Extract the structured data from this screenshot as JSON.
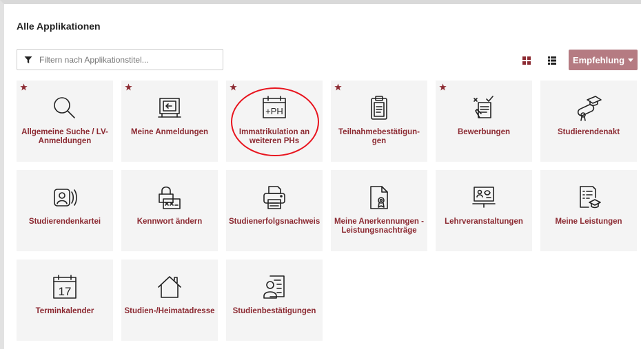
{
  "page": {
    "title": "Alle Applikationen"
  },
  "filter": {
    "placeholder": "Filtern nach Applikationstitel..."
  },
  "toolbar": {
    "recommend_label": "Empfehlung"
  },
  "colors": {
    "accent": "#8c2a32",
    "button": "#b57b82",
    "tile_bg": "#f4f4f4",
    "highlight": "#e8141e"
  },
  "tiles": [
    {
      "label": "Allgemeine Suche / LV-Anmeldungen",
      "icon": "search-icon",
      "favorite": true
    },
    {
      "label": "Meine Anmeldungen",
      "icon": "signin-icon",
      "favorite": true
    },
    {
      "label": "Immatrikulation an weiteren PHs",
      "icon": "calendar-plus-ph-icon",
      "favorite": true,
      "highlighted": true
    },
    {
      "label": "Teilnahmebestätigun-gen",
      "icon": "clipboard-icon",
      "favorite": true
    },
    {
      "label": "Bewerbungen",
      "icon": "application-writing-icon",
      "favorite": true
    },
    {
      "label": "Studierendenakt",
      "icon": "diploma-cap-icon",
      "favorite": false
    },
    {
      "label": "Studierendenkartei",
      "icon": "id-card-icon",
      "favorite": false
    },
    {
      "label": "Kennwort ändern",
      "icon": "password-lock-icon",
      "favorite": false
    },
    {
      "label": "Studienerfolgsnachweis",
      "icon": "printer-icon",
      "favorite": false
    },
    {
      "label": "Meine Anerkennungen - Leistungsnachträge",
      "icon": "certificate-document-icon",
      "favorite": false
    },
    {
      "label": "Lehrveranstaltungen",
      "icon": "teaching-board-icon",
      "favorite": false
    },
    {
      "label": "Meine Leistungen",
      "icon": "grades-document-icon",
      "favorite": false
    },
    {
      "label": "Terminkalender",
      "icon": "calendar-17-icon",
      "favorite": false,
      "day": "17"
    },
    {
      "label": "Studien-/Heimatadresse",
      "icon": "home-icon",
      "favorite": false
    },
    {
      "label": "Studienbestätigungen",
      "icon": "confirmation-document-icon",
      "favorite": false
    }
  ]
}
